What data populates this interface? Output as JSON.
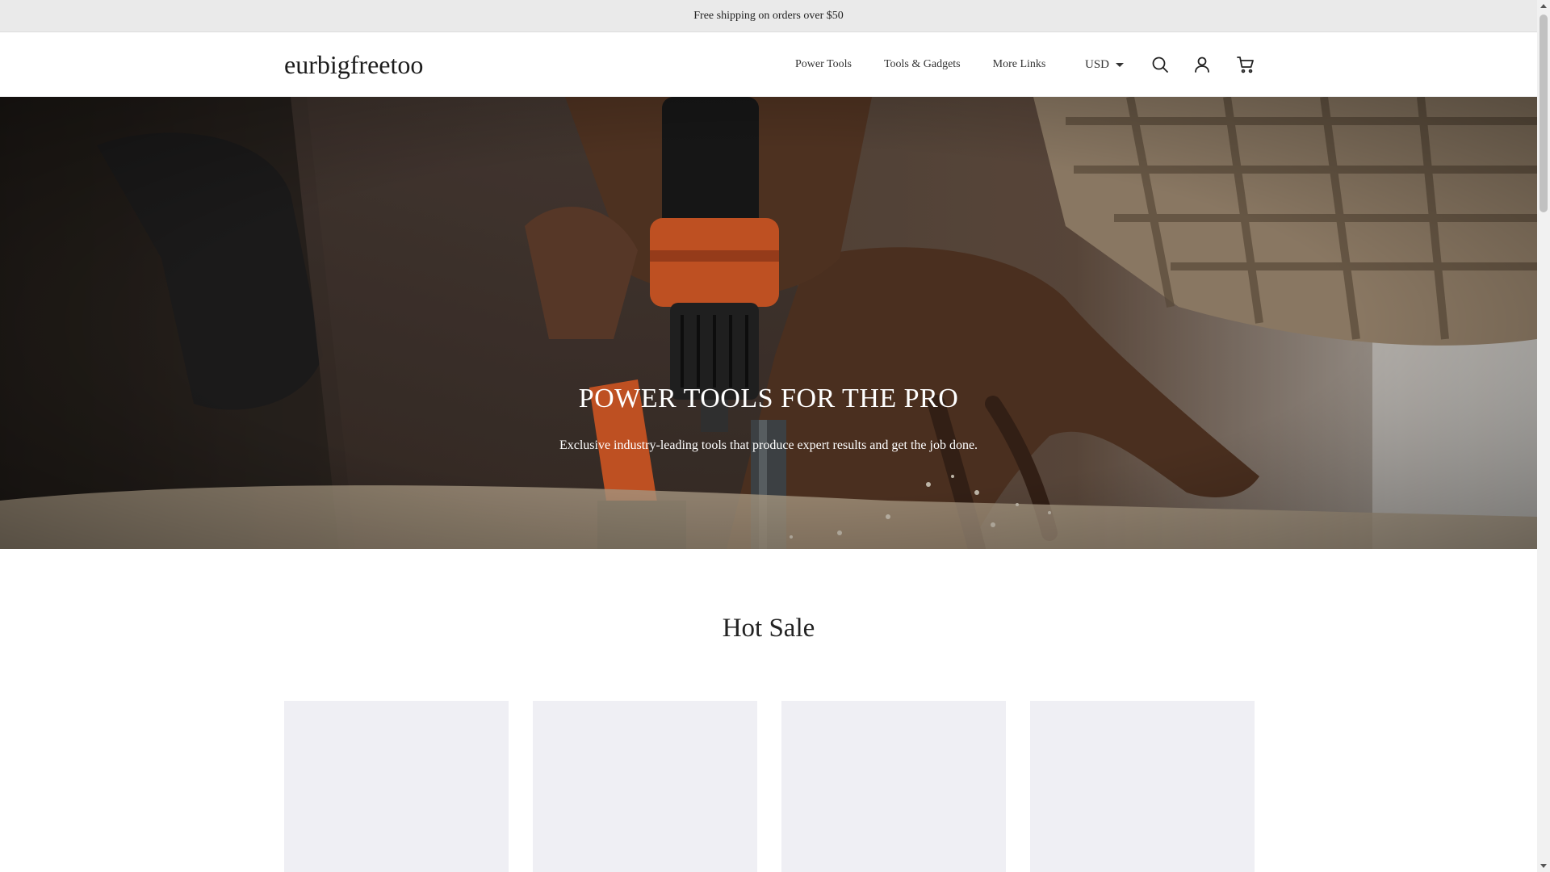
{
  "announcement": "Free shipping on orders over $50",
  "header": {
    "logo": "eurbigfreetoo",
    "nav": [
      "Power Tools",
      "Tools & Gadgets",
      "More Links"
    ],
    "currency": "USD",
    "icons": [
      "search-icon",
      "account-icon",
      "cart-icon"
    ]
  },
  "hero": {
    "title": "POWER TOOLS FOR THE PRO",
    "subtitle": "Exclusive industry-leading tools that produce expert results and get the job done."
  },
  "section": {
    "title": "Hot Sale",
    "product_count": 4
  },
  "colors": {
    "announcement_bg": "#eaeaea",
    "card_bg": "#efeff4",
    "text": "#222222",
    "drill_accent": "#e8622a"
  }
}
